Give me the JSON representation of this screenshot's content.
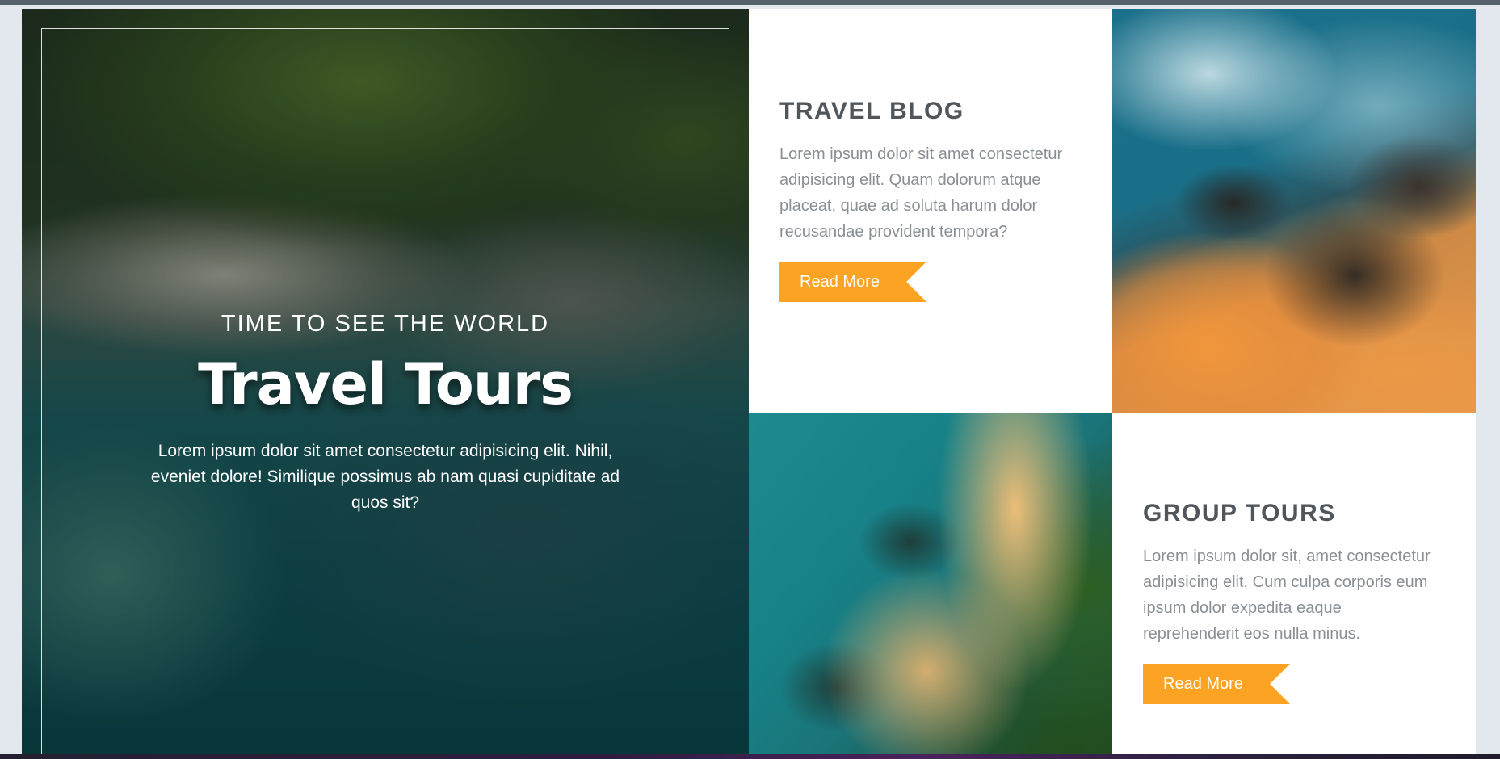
{
  "hero": {
    "kicker": "TIME TO SEE THE WORLD",
    "title": "Travel Tours",
    "text": "Lorem ipsum dolor sit amet consectetur adipisicing elit. Nihil, eveniet dolore! Similique possimus ab nam quasi cupiditate ad quos sit?"
  },
  "cards": {
    "blog": {
      "title": "TRAVEL BLOG",
      "text": "Lorem ipsum dolor sit amet consectetur adipisicing elit. Quam dolorum atque placeat, quae ad soluta harum dolor recusandae provident tempora?",
      "button": "Read More"
    },
    "group": {
      "title": "GROUP TOURS",
      "text": "Lorem ipsum dolor sit, amet consectetur adipisicing elit. Cum culpa corporis eum ipsum dolor expedita eaque reprehenderit eos nulla minus.",
      "button": "Read More"
    }
  },
  "colors": {
    "accent": "#fda324",
    "heading": "#4f565c",
    "body_text": "#8a8f95"
  }
}
